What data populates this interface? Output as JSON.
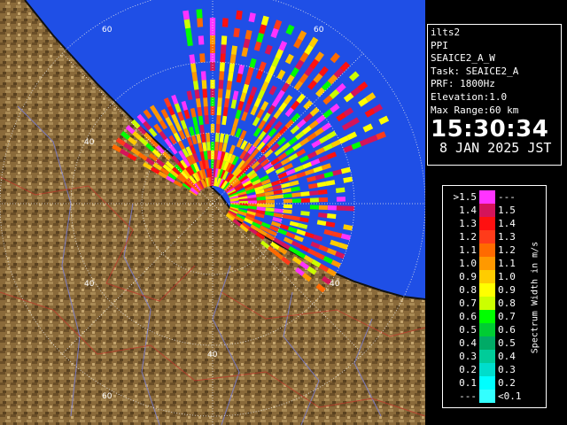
{
  "info": {
    "radar": "ilts2",
    "product": "PPI",
    "site": "SEAICE2_A_W",
    "task": "Task: SEAICE2_A",
    "prf": "PRF: 1800Hz",
    "elevation": "Elevation:1.0",
    "max_range": "Max Range:60 km",
    "time": "15:30:34",
    "date": "8 JAN 2025 JST"
  },
  "map": {
    "ring_labels": [
      {
        "text": "60"
      },
      {
        "text": "60"
      },
      {
        "text": "40"
      },
      {
        "text": "40"
      },
      {
        "text": "40"
      },
      {
        "text": "40"
      },
      {
        "text": "60"
      }
    ],
    "colors": {
      "sea": "#1f4fe6",
      "land": "#8a6a3a",
      "coast": "#111111",
      "rings": "#e8e8e8"
    }
  },
  "legend": {
    "unit_label": "Spectrum Width in m/s",
    "rows": [
      {
        "low": ">1.5",
        "high": "---",
        "color": "#ff33ff"
      },
      {
        "low": "1.4",
        "high": "1.5",
        "color": "#d4145a"
      },
      {
        "low": "1.3",
        "high": "1.4",
        "color": "#ff1010"
      },
      {
        "low": "1.2",
        "high": "1.3",
        "color": "#ff3b1a"
      },
      {
        "low": "1.1",
        "high": "1.2",
        "color": "#ff6a00"
      },
      {
        "low": "1.0",
        "high": "1.1",
        "color": "#ff9900"
      },
      {
        "low": "0.9",
        "high": "1.0",
        "color": "#ffcc00"
      },
      {
        "low": "0.8",
        "high": "0.9",
        "color": "#ffff00"
      },
      {
        "low": "0.7",
        "high": "0.8",
        "color": "#ccff00"
      },
      {
        "low": "0.6",
        "high": "0.7",
        "color": "#00ff00"
      },
      {
        "low": "0.5",
        "high": "0.6",
        "color": "#00cc33"
      },
      {
        "low": "0.4",
        "high": "0.5",
        "color": "#00aa66"
      },
      {
        "low": "0.3",
        "high": "0.4",
        "color": "#00cc99"
      },
      {
        "low": "0.2",
        "high": "0.3",
        "color": "#00ddcc"
      },
      {
        "low": "0.1",
        "high": "0.2",
        "color": "#00ffff"
      },
      {
        "low": "---",
        "high": "<0.1",
        "color": "#33ffff"
      }
    ]
  }
}
